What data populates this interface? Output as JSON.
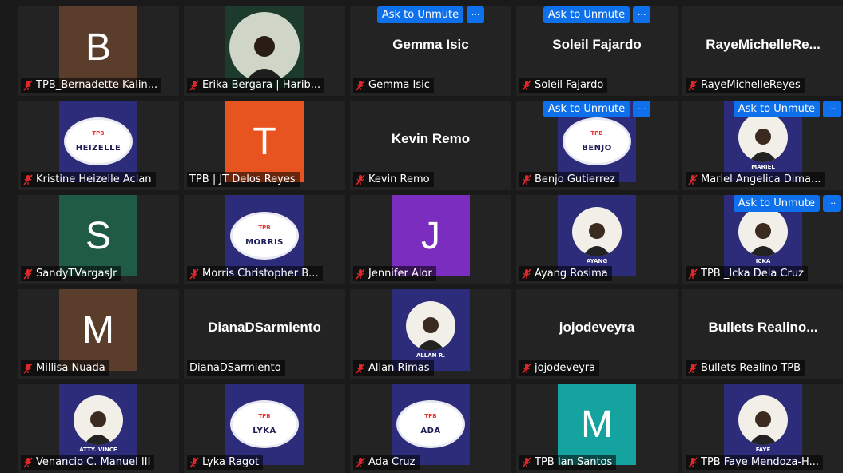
{
  "colors": {
    "unmute": "#0e71eb",
    "mic_off": "#e02828"
  },
  "unmute_label": "Ask to Unmute",
  "more_label": "···",
  "tiles": [
    {
      "label": "TPB_Bernadette Kalin...",
      "kind": "letter",
      "letter": "B",
      "bg": "#5a3d2b"
    },
    {
      "label": "Erika Bergara | Harib...",
      "kind": "photo_round",
      "muted": true
    },
    {
      "label": "Gemma Isic",
      "kind": "name",
      "name": "Gemma Isic",
      "unmute": true
    },
    {
      "label": "Soleil Fajardo",
      "kind": "name",
      "name": "Soleil Fajardo",
      "unmute": true
    },
    {
      "label": "RayeMichelleReyes",
      "kind": "name",
      "name": "RayeMichelleRe..."
    },
    {
      "label": "Kristine Heizelle Aclan",
      "kind": "badge",
      "badge": "HEIZELLE"
    },
    {
      "label": "TPB | JT Delos Reyes",
      "kind": "letter",
      "letter": "T",
      "bg": "#e8541f",
      "nomic": true
    },
    {
      "label": "Kevin Remo",
      "kind": "name",
      "name": "Kevin Remo"
    },
    {
      "label": "Benjo Gutierrez",
      "kind": "badge",
      "badge": "BENJO",
      "unmute": true
    },
    {
      "label": "Mariel Angelica Dima...",
      "kind": "photo",
      "caption": "MARIEL",
      "unmute": true,
      "unmute_right": true
    },
    {
      "label": "SandyTVargasJr",
      "kind": "letter",
      "letter": "S",
      "bg": "#1f5b45"
    },
    {
      "label": "Morris Christopher B...",
      "kind": "badge",
      "badge": "MORRIS"
    },
    {
      "label": "Jennifer Alor",
      "kind": "letter",
      "letter": "J",
      "bg": "#7a2dbf"
    },
    {
      "label": "Ayang Rosima",
      "kind": "photo",
      "caption": "AYANG"
    },
    {
      "label": "TPB _Icka Dela Cruz",
      "kind": "photo",
      "caption": "ICKA",
      "unmute": true,
      "unmute_right": true
    },
    {
      "label": "Millisa Nuada",
      "kind": "letter",
      "letter": "M",
      "bg": "#5a3d2b"
    },
    {
      "label": "DianaDSarmiento",
      "kind": "name",
      "name": "DianaDSarmiento",
      "nomic": true
    },
    {
      "label": "Allan Rimas",
      "kind": "photo",
      "caption": "ALLAN R."
    },
    {
      "label": "jojodeveyra",
      "kind": "name",
      "name": "jojodeveyra"
    },
    {
      "label": "Bullets Realino TPB",
      "kind": "name",
      "name": "Bullets  Realino..."
    },
    {
      "label": "Venancio C. Manuel III",
      "kind": "photo",
      "caption": "ATTY. VINCE"
    },
    {
      "label": "Lyka Ragot",
      "kind": "badge",
      "badge": "LYKA"
    },
    {
      "label": "Ada Cruz",
      "kind": "badge",
      "badge": "ADA"
    },
    {
      "label": "TPB Ian Santos",
      "kind": "letter",
      "letter": "M",
      "bg": "#14a39e"
    },
    {
      "label": "TPB Faye Mendoza-H...",
      "kind": "photo",
      "caption": "FAYE"
    }
  ]
}
